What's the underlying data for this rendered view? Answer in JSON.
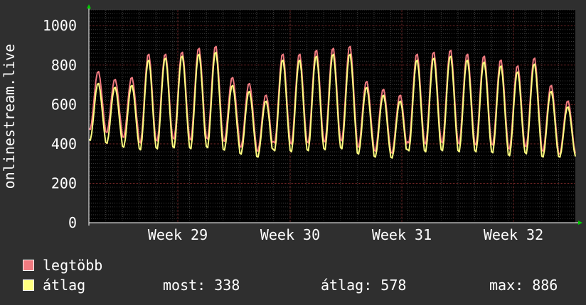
{
  "chart_data": {
    "type": "line",
    "title": "",
    "xlabel": "",
    "ylabel": "onlinestream.live",
    "ylim": [
      0,
      1080
    ],
    "yticks": [
      0,
      200,
      400,
      600,
      800,
      1000
    ],
    "xticks": [
      "Week 29",
      "Week 30",
      "Week 31",
      "Week 32"
    ],
    "grid": true,
    "daily_cycles": 29,
    "series": [
      {
        "name": "legtöbb",
        "color": "#f07a80",
        "values": [
          [
            470,
            770
          ],
          [
            455,
            730
          ],
          [
            430,
            740
          ],
          [
            400,
            860
          ],
          [
            410,
            860
          ],
          [
            420,
            870
          ],
          [
            415,
            890
          ],
          [
            420,
            900
          ],
          [
            410,
            740
          ],
          [
            380,
            710
          ],
          [
            360,
            650
          ],
          [
            400,
            860
          ],
          [
            395,
            860
          ],
          [
            400,
            880
          ],
          [
            405,
            890
          ],
          [
            410,
            900
          ],
          [
            380,
            720
          ],
          [
            360,
            680
          ],
          [
            350,
            650
          ],
          [
            400,
            860
          ],
          [
            395,
            870
          ],
          [
            400,
            880
          ],
          [
            395,
            860
          ],
          [
            390,
            850
          ],
          [
            390,
            830
          ],
          [
            370,
            800
          ],
          [
            380,
            840
          ],
          [
            360,
            700
          ],
          [
            345,
            620
          ]
        ]
      },
      {
        "name": "átlag",
        "color": "#ffff80",
        "values": [
          [
            415,
            710
          ],
          [
            400,
            690
          ],
          [
            380,
            700
          ],
          [
            365,
            830
          ],
          [
            370,
            840
          ],
          [
            375,
            850
          ],
          [
            370,
            860
          ],
          [
            375,
            870
          ],
          [
            365,
            700
          ],
          [
            345,
            670
          ],
          [
            330,
            620
          ],
          [
            360,
            830
          ],
          [
            355,
            830
          ],
          [
            360,
            850
          ],
          [
            365,
            860
          ],
          [
            370,
            860
          ],
          [
            345,
            690
          ],
          [
            330,
            650
          ],
          [
            325,
            620
          ],
          [
            360,
            830
          ],
          [
            355,
            840
          ],
          [
            360,
            850
          ],
          [
            355,
            830
          ],
          [
            355,
            820
          ],
          [
            350,
            800
          ],
          [
            335,
            770
          ],
          [
            345,
            810
          ],
          [
            330,
            670
          ],
          [
            330,
            590
          ]
        ]
      }
    ],
    "stats": {
      "most": "most: 338",
      "atlag": "átlag: 578",
      "max": "max: 886"
    }
  }
}
